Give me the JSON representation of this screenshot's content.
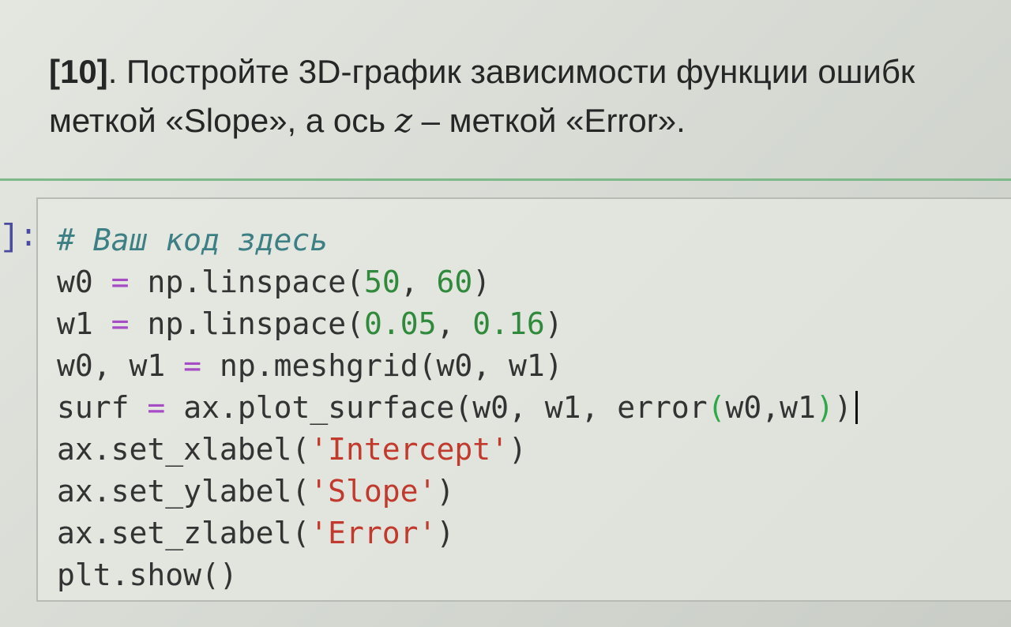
{
  "task": {
    "number": "[10]",
    "line1_text": ". Постройте 3D-график зависимости функции ошибк",
    "line2_before": "меткой «Slope», а ось ",
    "line2_var": "z",
    "line2_after": " – меткой «Error»."
  },
  "cell": {
    "prompt": "]:",
    "comment": "# Ваш код здесь",
    "line1": {
      "var": "w0",
      "op": "=",
      "call": "np.linspace(",
      "a": "50",
      "sep": ", ",
      "b": "60",
      "close": ")"
    },
    "line2": {
      "var": "w1",
      "op": "=",
      "call": "np.linspace(",
      "a": "0.05",
      "sep": ", ",
      "b": "0.16",
      "close": ")"
    },
    "line3": {
      "var": "w0, w1",
      "op": "=",
      "call": "np.meshgrid(w0, w1)"
    },
    "line4": {
      "var": "surf",
      "op": "=",
      "call": "ax.plot_surface(w0, w1, error",
      "inner_open": "(",
      "inner_args": "w0,w1",
      "inner_close": ")",
      "close": ")"
    },
    "line5": {
      "call": "ax.set_xlabel(",
      "str": "'Intercept'",
      "close": ")"
    },
    "line6": {
      "call": "ax.set_ylabel(",
      "str": "'Slope'",
      "close": ")"
    },
    "line7": {
      "call": "ax.set_zlabel(",
      "str": "'Error'",
      "close": ")"
    },
    "line8": {
      "call": "plt.show()"
    }
  },
  "colors": {
    "comment": "#3c7f84",
    "operator": "#a64cc4",
    "number": "#2f8a3b",
    "string": "#c23a2e",
    "prompt": "#4a4a9e",
    "divider": "#7fb98a"
  }
}
